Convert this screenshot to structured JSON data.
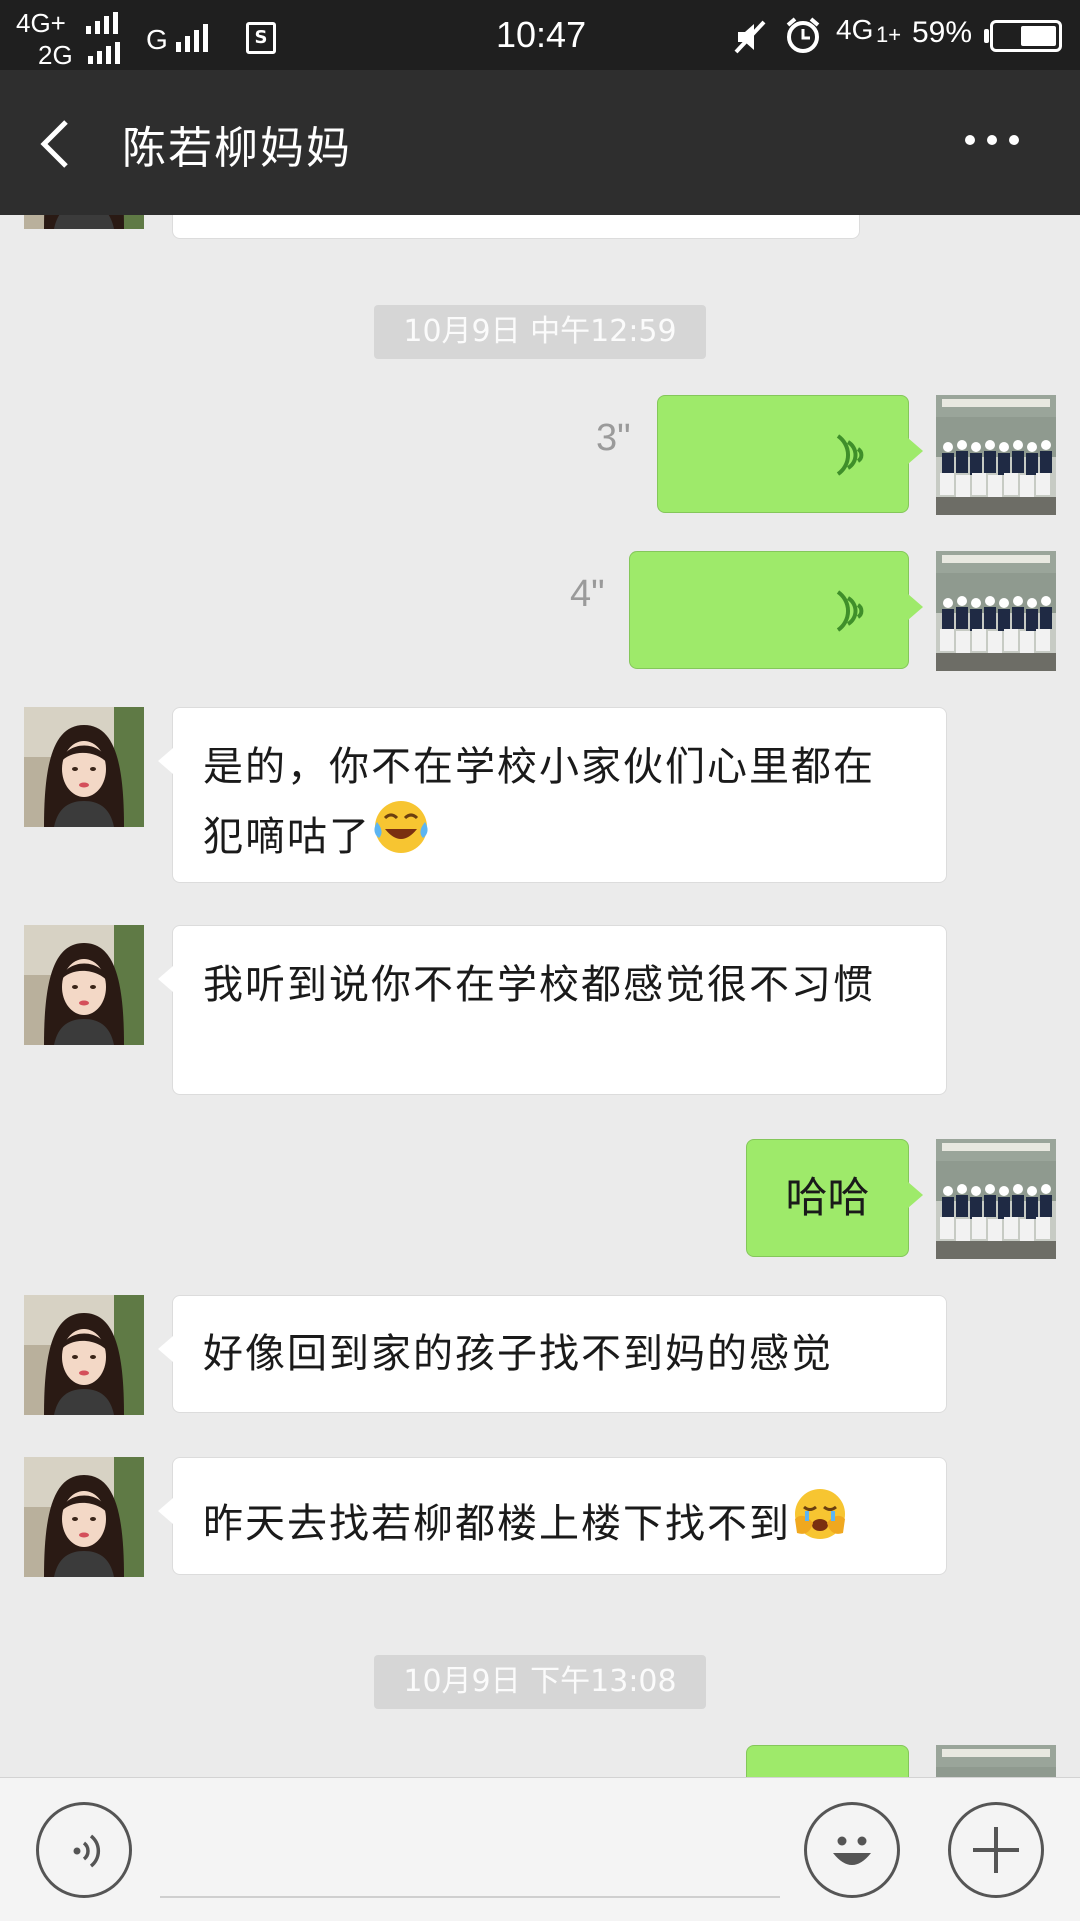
{
  "status_bar": {
    "network1": "4G+",
    "network2": "2G",
    "network3": "G",
    "sim_icon_label": "S",
    "time": "10:47",
    "network4": "4G",
    "network4_sub": "1+",
    "battery_percent": "59%",
    "battery_level": 0.59
  },
  "header": {
    "back_icon": "chevron-left-icon",
    "title": "陈若柳妈妈",
    "more_icon": "more-dots-icon"
  },
  "chat": {
    "timestamp1": "10月9日 中午12:59",
    "timestamp2": "10月9日 下午13:08",
    "voice1_duration": "3\"",
    "voice2_duration": "4\"",
    "msg1": "是的，你不在学校小家伙们心里都在犯嘀咕了",
    "msg1_emoji": "tears-of-joy-emoji",
    "msg2": "我听到说你不在学校都感觉很不习惯",
    "msg3_out": "哈哈",
    "msg4": "好像回到家的孩子找不到妈的感觉",
    "msg5": "昨天去找若柳都楼上楼下找不到",
    "msg5_emoji": "crying-emoji"
  },
  "input_bar": {
    "voice_icon": "voice-input-icon",
    "emoji_icon": "smiley-icon",
    "plus_icon": "plus-icon"
  },
  "colors": {
    "status_bar_bg": "#1f1f1f",
    "title_bar_bg": "#2e2e2e",
    "chat_bg": "#ebebeb",
    "outgoing_bubble": "#9eea6a",
    "incoming_bubble": "#ffffff",
    "timestamp_chip": "#d6d6d6"
  }
}
